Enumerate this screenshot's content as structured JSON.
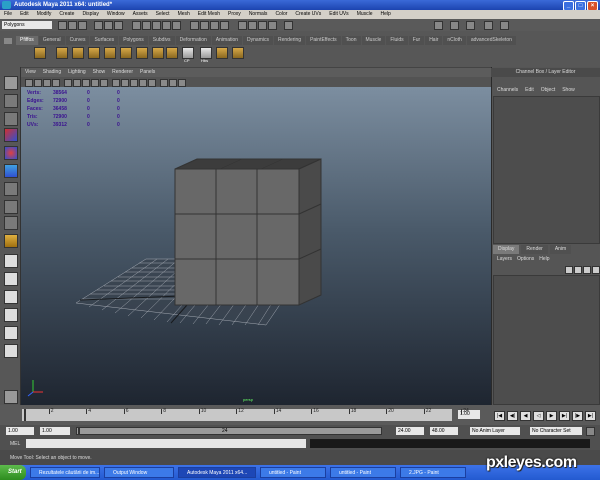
{
  "window": {
    "title": "Autodesk Maya 2011 x64: untitled*"
  },
  "menubar": {
    "items": [
      "File",
      "Edit",
      "Modify",
      "Create",
      "Display",
      "Window",
      "Assets",
      "Select",
      "Mesh",
      "Edit Mesh",
      "Proxy",
      "Normals",
      "Color",
      "Create UVs",
      "Edit UVs",
      "Muscle",
      "Help"
    ]
  },
  "statusline": {
    "mode": "Polygons"
  },
  "shelf": {
    "tabs": [
      "Pfiffos",
      "General",
      "Curves",
      "Surfaces",
      "Polygons",
      "Subdivs",
      "Deformation",
      "Animation",
      "Dynamics",
      "Rendering",
      "PaintEffects",
      "Toon",
      "Muscle",
      "Fluids",
      "Fur",
      "Hair",
      "nCloth",
      "advancedSkeleton"
    ],
    "active_tab": "Pfiffos",
    "labels": [
      "CP",
      "Hbs"
    ]
  },
  "panel": {
    "menu": [
      "View",
      "Shading",
      "Lighting",
      "Show",
      "Renderer",
      "Panels"
    ]
  },
  "hud": {
    "rows": [
      {
        "label": "Verts:",
        "value": "38564",
        "a": "0",
        "b": "0"
      },
      {
        "label": "Edges:",
        "value": "72900",
        "a": "0",
        "b": "0"
      },
      {
        "label": "Faces:",
        "value": "36458",
        "a": "0",
        "b": "0"
      },
      {
        "label": "Tris:",
        "value": "72900",
        "a": "0",
        "b": "0"
      },
      {
        "label": "UVs:",
        "value": "39312",
        "a": "0",
        "b": "0"
      }
    ],
    "view_label": "persp"
  },
  "channel_box": {
    "title": "Channel Box / Layer Editor",
    "menu": [
      "Channels",
      "Edit",
      "Object",
      "Show"
    ]
  },
  "layer_editor": {
    "tabs": [
      "Display",
      "Render",
      "Anim"
    ],
    "active_tab": "Display",
    "menu": [
      "Layers",
      "Options",
      "Help"
    ]
  },
  "time_slider": {
    "ticks": [
      "2",
      "4",
      "6",
      "8",
      "10",
      "12",
      "14",
      "16",
      "18",
      "20",
      "22",
      "24"
    ],
    "current_frame": "1.00"
  },
  "range_slider": {
    "start": "1.00",
    "start_inner": "1.00",
    "inner_label": "24",
    "end_inner": "24.00",
    "end": "48.00",
    "anim_layer": "No Anim Layer",
    "character_set": "No Character Set"
  },
  "command_line": {
    "label": "MEL"
  },
  "help_line": {
    "text": "Move Tool: Select an object to move."
  },
  "taskbar": {
    "start": "Start",
    "tasks": [
      "Rezultatele căutării de im...",
      "Output Window",
      "Autodesk Maya 2011 x64...",
      "untitled - Paint",
      "untitled - Paint",
      "2.JPG - Paint"
    ],
    "active_index": 2
  },
  "watermark": "pxleyes.com",
  "colors": {
    "titlebar": "#2a58c8",
    "viewport_top": "#7c8ea0",
    "viewport_bottom": "#1e2530",
    "hud_text": "#3a1090"
  }
}
